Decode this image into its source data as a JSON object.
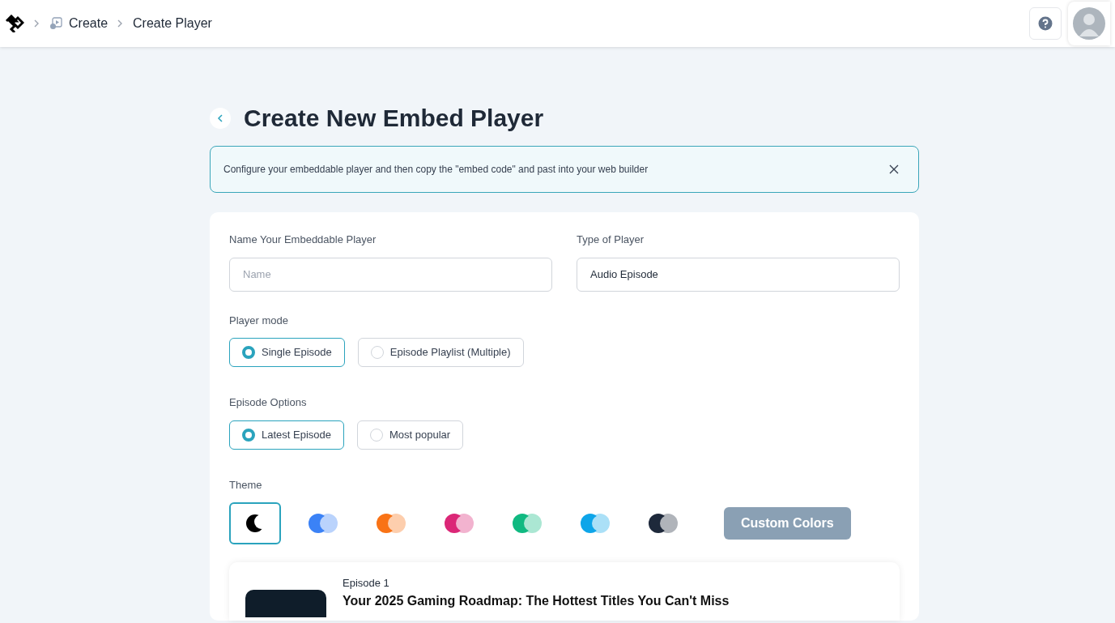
{
  "breadcrumb": [
    {
      "label": "Create",
      "icon": true
    },
    {
      "label": "Create Player",
      "icon": false
    }
  ],
  "page_title": "Create New Embed Player",
  "alert": {
    "text": "Configure your embeddable player and then copy the \"embed code\" and past into your web builder"
  },
  "form": {
    "name_label": "Name Your Embeddable Player",
    "name_placeholder": "Name",
    "type_label": "Type of Player",
    "type_value": "Audio Episode",
    "mode_label": "Player mode",
    "modes": [
      {
        "label": "Single Episode",
        "selected": true
      },
      {
        "label": "Episode Playlist (Multiple)",
        "selected": false
      }
    ],
    "options_label": "Episode Options",
    "options": [
      {
        "label": "Latest Episode",
        "selected": true
      },
      {
        "label": "Most popular",
        "selected": false
      }
    ],
    "theme_label": "Theme",
    "themes": [
      {
        "kind": "moon",
        "selected": true,
        "color": "#000000"
      },
      {
        "kind": "pair",
        "selected": false,
        "color": "#3b82f6"
      },
      {
        "kind": "pair",
        "selected": false,
        "color": "#f97316"
      },
      {
        "kind": "pair",
        "selected": false,
        "color": "#db2777"
      },
      {
        "kind": "pair",
        "selected": false,
        "color": "#10b981"
      },
      {
        "kind": "pair",
        "selected": false,
        "color": "#0ea5e9"
      },
      {
        "kind": "pair",
        "selected": false,
        "color": "#1e293b"
      }
    ],
    "custom_button": "Custom Colors"
  },
  "preview": {
    "episode_label": "Episode 1",
    "title": "Your 2025 Gaming Roadmap: The Hottest Titles You Can't Miss"
  }
}
